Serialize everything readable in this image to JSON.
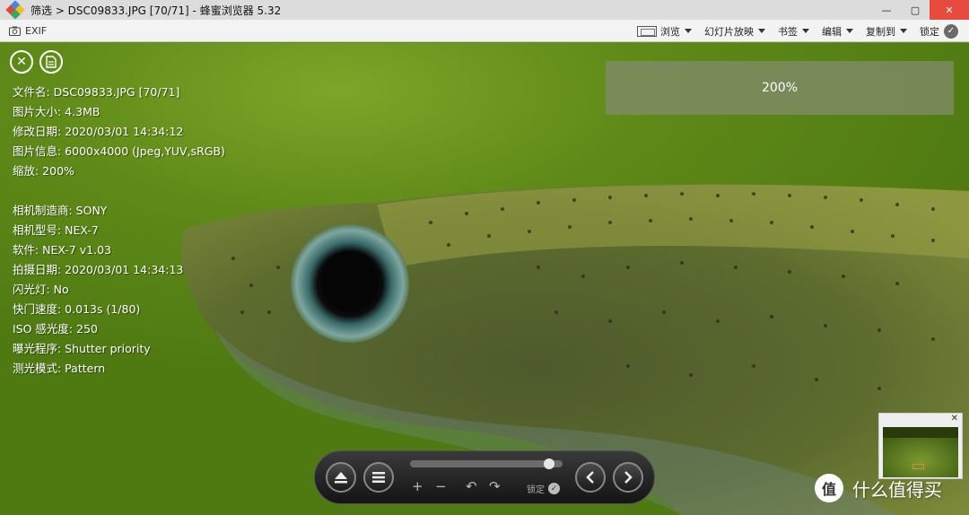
{
  "window": {
    "title": "筛选 > DSC09833.JPG [70/71] - 蜂蜜浏览器 5.32",
    "minimize_label": "—",
    "maximize_label": "▢",
    "close_label": "✕"
  },
  "toolbar": {
    "exif_label": "EXIF",
    "browse_label": "浏览",
    "slideshow_label": "幻灯片放映",
    "bookmark_label": "书签",
    "edit_label": "编辑",
    "copyto_label": "复制到",
    "lock_label": "锁定"
  },
  "info": {
    "filename": "文件名: DSC09833.JPG [70/71]",
    "filesize": "图片大小: 4.3MB",
    "modified": "修改日期: 2020/03/01 14:34:12",
    "imageinfo": "图片信息: 6000x4000 (Jpeg,YUV,sRGB)",
    "zoom": "缩放: 200%",
    "make": "相机制造商: SONY",
    "model": "相机型号: NEX-7",
    "software": "软件: NEX-7 v1.03",
    "shot_date": "拍摄日期: 2020/03/01 14:34:13",
    "flash": "闪光灯: No",
    "shutter": "快门速度: 0.013s (1/80)",
    "iso": "ISO 感光度: 250",
    "program": "曝光程序: Shutter priority",
    "metering": "测光模式: Pattern"
  },
  "zoom_overlay": {
    "text": "200%"
  },
  "navbar": {
    "progress": 0.94,
    "lock_label": "锁定",
    "zoom_in": "+",
    "zoom_out": "−",
    "rotate_left": "↶",
    "rotate_right": "↷"
  },
  "minimap": {
    "close_label": "✕"
  },
  "watermark": {
    "badge": "值",
    "text": "什么值得买"
  },
  "colors": {
    "accent_close": "#e84a3e",
    "minimap_marker": "#e8863a"
  }
}
